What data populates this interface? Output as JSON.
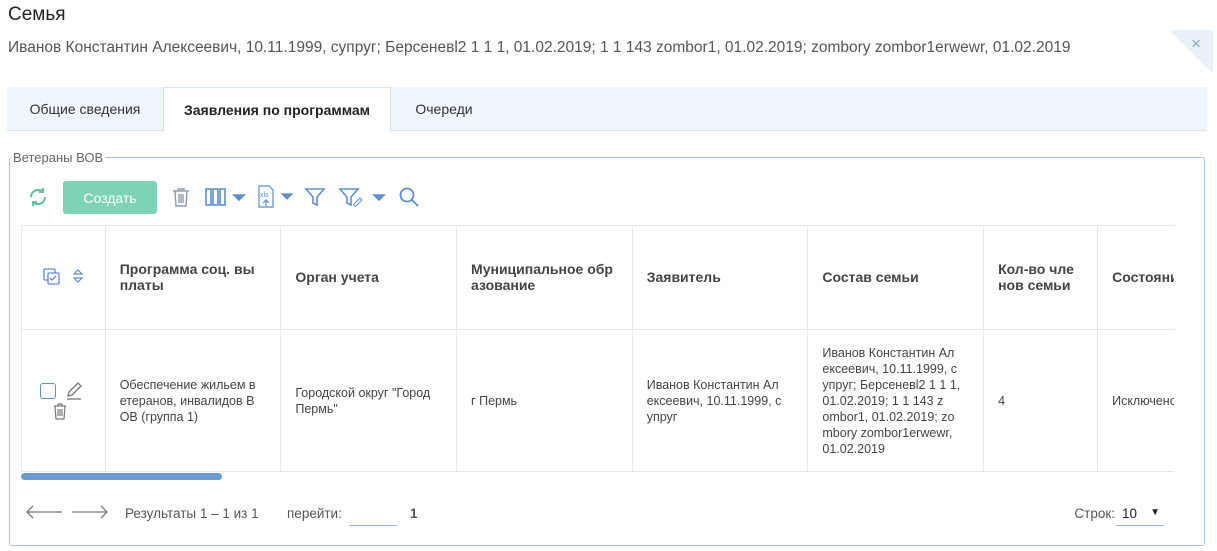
{
  "header": {
    "title": "Семья",
    "members": "Иванов Константин Алексеевич, 10.11.1999, супруг; Берсеневl2 1 1 1, 01.02.2019; 1 1 143 zombor1, 01.02.2019; zombory zombor1erwewr, 01.02.2019",
    "close_icon": "×"
  },
  "tabs": [
    {
      "label": "Общие сведения",
      "active": false
    },
    {
      "label": "Заявления по программам",
      "active": true
    },
    {
      "label": "Очереди",
      "active": false
    }
  ],
  "group": {
    "legend": "Ветераны ВОВ"
  },
  "toolbar": {
    "create_label": "Создать",
    "export_label": "xls",
    "colors": {
      "icon": "#5b8fd0",
      "refresh": "#5cc39a",
      "create_bg": "#7ed3b4"
    }
  },
  "table": {
    "columns": [
      "Программа соц. вы платы",
      "Орган учета",
      "Муниципальное обр азование",
      "Заявитель",
      "Состав семьи",
      "Кол-во чле нов семьи",
      "Состояние"
    ],
    "rows": [
      {
        "program": "Обеспечение жильем в етеранов, инвалидов В ОВ (группа 1)",
        "authority": "Городской округ \"Город Пермь\"",
        "municipality": "г Пермь",
        "applicant": "Иванов Константин Ал ексеевич, 10.11.1999, с упруг",
        "family": "Иванов Константин Ал ексеевич, 10.11.1999, с упруг; Берсеневl2 1 1 1, 01.02.2019; 1 1 143 z ombor1, 01.02.2019; zo mbory zombor1erwewr, 01.02.2019",
        "count": "4",
        "status": "Исключено"
      }
    ]
  },
  "pager": {
    "results": "Результаты 1 – 1 из 1",
    "goto_label": "перейти:",
    "goto_value": "",
    "page": "1",
    "rows_label": "Строк:",
    "rows_value": "10"
  }
}
